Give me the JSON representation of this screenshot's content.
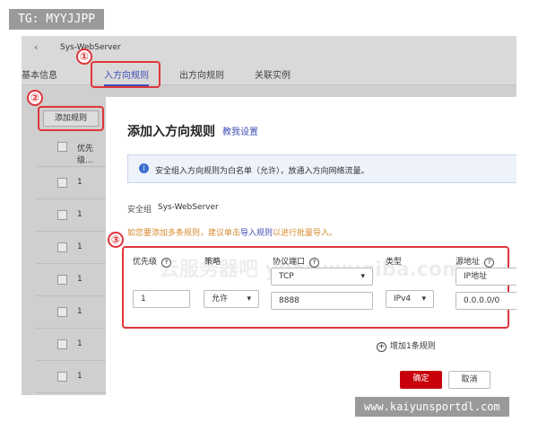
{
  "overlay_tag": "TG: MYYJJPP",
  "overlay_url": "www.kaiyunsportdl.com",
  "header": {
    "back_icon": "chevron-left-icon",
    "title": "Sys-WebServer"
  },
  "tabs": [
    {
      "label": "基本信息"
    },
    {
      "label": "入方向规则",
      "active": true
    },
    {
      "label": "出方向规则"
    },
    {
      "label": "关联实例"
    }
  ],
  "markers": [
    "①",
    "②",
    "③"
  ],
  "list": {
    "add_button": "添加规则",
    "header": "优先级...",
    "rows": [
      "1",
      "1",
      "1",
      "1",
      "1",
      "1",
      "1"
    ]
  },
  "modal": {
    "title": "添加入方向规则",
    "help_link": "教我设置",
    "info": "安全组入方向规则为白名单（允许），放通入方向网络流量。",
    "sg_label": "安全组",
    "sg_value": "Sys-WebServer",
    "tip_pre": "如您要添加多条规则，建议单击",
    "tip_link": "导入规则",
    "tip_post": "以进行批量导入。",
    "columns": {
      "priority": "优先级",
      "policy": "策略",
      "protocol": "协议端口",
      "type": "类型",
      "source": "源地址"
    },
    "rule": {
      "priority": "1",
      "policy": "允许",
      "protocol": "TCP",
      "port": "8888",
      "type": "IPv4",
      "source_type": "IP地址",
      "source": "0.0.0.0/0"
    },
    "add_rule": "增加1条规则",
    "confirm": "确定",
    "cancel": "取消",
    "watermark": "云服务器吧 yunfuwuqiba.com"
  },
  "colors": {
    "accent": "#3f51b5",
    "danger": "#c7000b",
    "marker": "#e0353b",
    "tip": "#d68a2e"
  }
}
